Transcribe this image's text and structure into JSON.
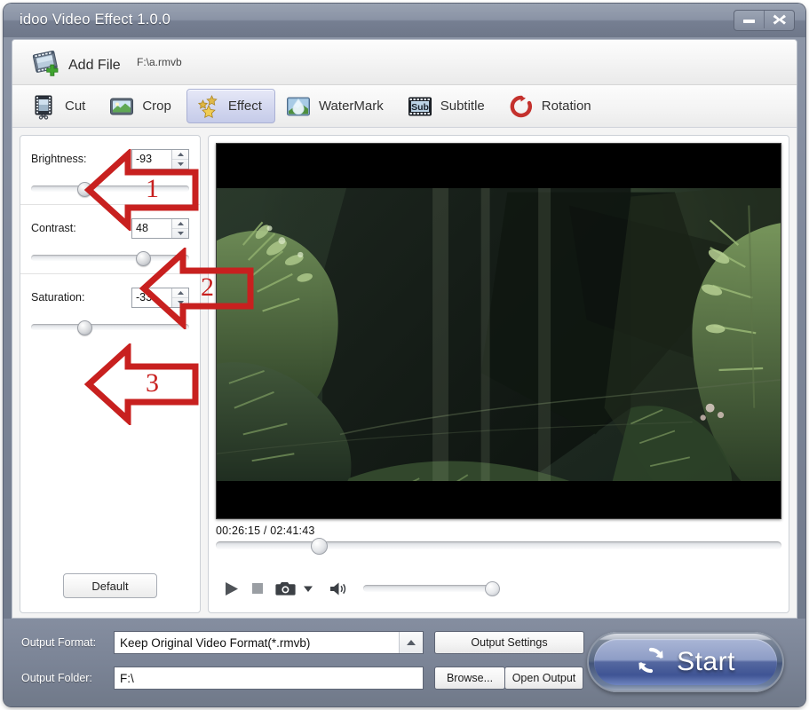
{
  "window": {
    "title": "idoo Video Effect 1.0.0",
    "minimize_label": "Minimize",
    "close_label": "Close"
  },
  "toolbar": {
    "add_file_label": "Add File",
    "file_path": "F:\\a.rmvb",
    "add_file_icon": "add-file-icon"
  },
  "tabs": [
    {
      "label": "Cut",
      "icon": "film-strip-scissors-icon",
      "selected": false
    },
    {
      "label": "Crop",
      "icon": "crop-frame-icon",
      "selected": false
    },
    {
      "label": "Effect",
      "icon": "gold-stars-icon",
      "selected": true
    },
    {
      "label": "WaterMark",
      "icon": "water-drop-icon",
      "selected": false
    },
    {
      "label": "Subtitle",
      "icon": "sub-film-strip-icon",
      "selected": false
    },
    {
      "label": "Rotation",
      "icon": "circular-arrow-icon",
      "selected": false
    }
  ],
  "effects": {
    "sliders": [
      {
        "label": "Brightness:",
        "value": "-93",
        "percent": 33,
        "min": -100,
        "max": 100
      },
      {
        "label": "Contrast:",
        "value": "48",
        "percent": 70,
        "min": -100,
        "max": 100
      },
      {
        "label": "Saturation:",
        "value": "-33",
        "percent": 33,
        "min": -100,
        "max": 100
      }
    ],
    "default_button": "Default"
  },
  "player": {
    "time_current": "00:26:15",
    "time_total": "02:41:43",
    "time_display": "00:26:15 / 02:41:43",
    "seek_percent": 18,
    "volume_percent": 100,
    "controls": [
      {
        "name": "play-button",
        "icon": "play-icon"
      },
      {
        "name": "stop-button",
        "icon": "stop-icon"
      },
      {
        "name": "snapshot-button",
        "icon": "camera-icon"
      },
      {
        "name": "snapshot-menu",
        "icon": "chevron-down-icon"
      },
      {
        "name": "volume-button",
        "icon": "speaker-icon"
      }
    ]
  },
  "output": {
    "format_label": "Output Format:",
    "format_value": "Keep Original Video Format(*.rmvb)",
    "folder_label": "Output Folder:",
    "folder_value": "F:\\",
    "settings_button": "Output Settings",
    "browse_button": "Browse...",
    "open_output_button": "Open Output",
    "start_button": "Start",
    "start_icon": "refresh-circular-icon"
  },
  "annotations": [
    {
      "number": "1",
      "target": "brightness-slider"
    },
    {
      "number": "2",
      "target": "contrast-slider"
    },
    {
      "number": "3",
      "target": "saturation-slider"
    }
  ],
  "colors": {
    "frame": "#7b8496",
    "title_text": "#ffffff",
    "tab_selected": "#d3d7ef",
    "annotation_red": "#c8201f",
    "start_blue": "#4a5d92"
  }
}
